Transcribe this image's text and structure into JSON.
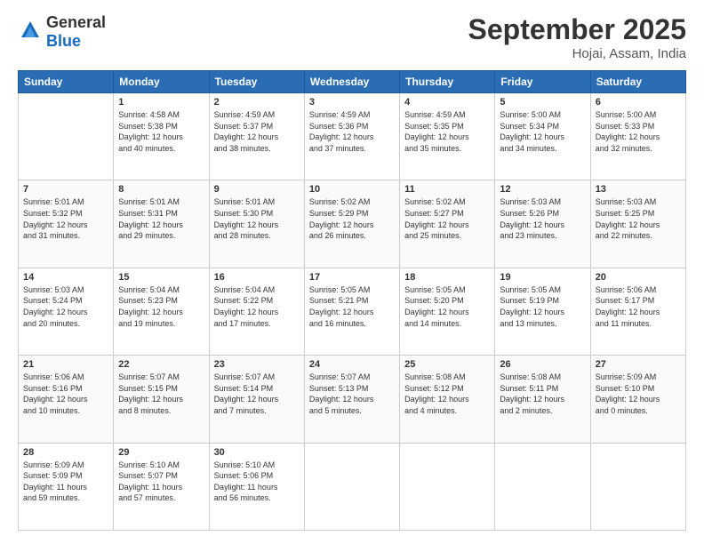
{
  "logo": {
    "general": "General",
    "blue": "Blue"
  },
  "header": {
    "month": "September 2025",
    "location": "Hojai, Assam, India"
  },
  "weekdays": [
    "Sunday",
    "Monday",
    "Tuesday",
    "Wednesday",
    "Thursday",
    "Friday",
    "Saturday"
  ],
  "weeks": [
    [
      {
        "day": "",
        "info": ""
      },
      {
        "day": "1",
        "info": "Sunrise: 4:58 AM\nSunset: 5:38 PM\nDaylight: 12 hours\nand 40 minutes."
      },
      {
        "day": "2",
        "info": "Sunrise: 4:59 AM\nSunset: 5:37 PM\nDaylight: 12 hours\nand 38 minutes."
      },
      {
        "day": "3",
        "info": "Sunrise: 4:59 AM\nSunset: 5:36 PM\nDaylight: 12 hours\nand 37 minutes."
      },
      {
        "day": "4",
        "info": "Sunrise: 4:59 AM\nSunset: 5:35 PM\nDaylight: 12 hours\nand 35 minutes."
      },
      {
        "day": "5",
        "info": "Sunrise: 5:00 AM\nSunset: 5:34 PM\nDaylight: 12 hours\nand 34 minutes."
      },
      {
        "day": "6",
        "info": "Sunrise: 5:00 AM\nSunset: 5:33 PM\nDaylight: 12 hours\nand 32 minutes."
      }
    ],
    [
      {
        "day": "7",
        "info": "Sunrise: 5:01 AM\nSunset: 5:32 PM\nDaylight: 12 hours\nand 31 minutes."
      },
      {
        "day": "8",
        "info": "Sunrise: 5:01 AM\nSunset: 5:31 PM\nDaylight: 12 hours\nand 29 minutes."
      },
      {
        "day": "9",
        "info": "Sunrise: 5:01 AM\nSunset: 5:30 PM\nDaylight: 12 hours\nand 28 minutes."
      },
      {
        "day": "10",
        "info": "Sunrise: 5:02 AM\nSunset: 5:29 PM\nDaylight: 12 hours\nand 26 minutes."
      },
      {
        "day": "11",
        "info": "Sunrise: 5:02 AM\nSunset: 5:27 PM\nDaylight: 12 hours\nand 25 minutes."
      },
      {
        "day": "12",
        "info": "Sunrise: 5:03 AM\nSunset: 5:26 PM\nDaylight: 12 hours\nand 23 minutes."
      },
      {
        "day": "13",
        "info": "Sunrise: 5:03 AM\nSunset: 5:25 PM\nDaylight: 12 hours\nand 22 minutes."
      }
    ],
    [
      {
        "day": "14",
        "info": "Sunrise: 5:03 AM\nSunset: 5:24 PM\nDaylight: 12 hours\nand 20 minutes."
      },
      {
        "day": "15",
        "info": "Sunrise: 5:04 AM\nSunset: 5:23 PM\nDaylight: 12 hours\nand 19 minutes."
      },
      {
        "day": "16",
        "info": "Sunrise: 5:04 AM\nSunset: 5:22 PM\nDaylight: 12 hours\nand 17 minutes."
      },
      {
        "day": "17",
        "info": "Sunrise: 5:05 AM\nSunset: 5:21 PM\nDaylight: 12 hours\nand 16 minutes."
      },
      {
        "day": "18",
        "info": "Sunrise: 5:05 AM\nSunset: 5:20 PM\nDaylight: 12 hours\nand 14 minutes."
      },
      {
        "day": "19",
        "info": "Sunrise: 5:05 AM\nSunset: 5:19 PM\nDaylight: 12 hours\nand 13 minutes."
      },
      {
        "day": "20",
        "info": "Sunrise: 5:06 AM\nSunset: 5:17 PM\nDaylight: 12 hours\nand 11 minutes."
      }
    ],
    [
      {
        "day": "21",
        "info": "Sunrise: 5:06 AM\nSunset: 5:16 PM\nDaylight: 12 hours\nand 10 minutes."
      },
      {
        "day": "22",
        "info": "Sunrise: 5:07 AM\nSunset: 5:15 PM\nDaylight: 12 hours\nand 8 minutes."
      },
      {
        "day": "23",
        "info": "Sunrise: 5:07 AM\nSunset: 5:14 PM\nDaylight: 12 hours\nand 7 minutes."
      },
      {
        "day": "24",
        "info": "Sunrise: 5:07 AM\nSunset: 5:13 PM\nDaylight: 12 hours\nand 5 minutes."
      },
      {
        "day": "25",
        "info": "Sunrise: 5:08 AM\nSunset: 5:12 PM\nDaylight: 12 hours\nand 4 minutes."
      },
      {
        "day": "26",
        "info": "Sunrise: 5:08 AM\nSunset: 5:11 PM\nDaylight: 12 hours\nand 2 minutes."
      },
      {
        "day": "27",
        "info": "Sunrise: 5:09 AM\nSunset: 5:10 PM\nDaylight: 12 hours\nand 0 minutes."
      }
    ],
    [
      {
        "day": "28",
        "info": "Sunrise: 5:09 AM\nSunset: 5:09 PM\nDaylight: 11 hours\nand 59 minutes."
      },
      {
        "day": "29",
        "info": "Sunrise: 5:10 AM\nSunset: 5:07 PM\nDaylight: 11 hours\nand 57 minutes."
      },
      {
        "day": "30",
        "info": "Sunrise: 5:10 AM\nSunset: 5:06 PM\nDaylight: 11 hours\nand 56 minutes."
      },
      {
        "day": "",
        "info": ""
      },
      {
        "day": "",
        "info": ""
      },
      {
        "day": "",
        "info": ""
      },
      {
        "day": "",
        "info": ""
      }
    ]
  ]
}
